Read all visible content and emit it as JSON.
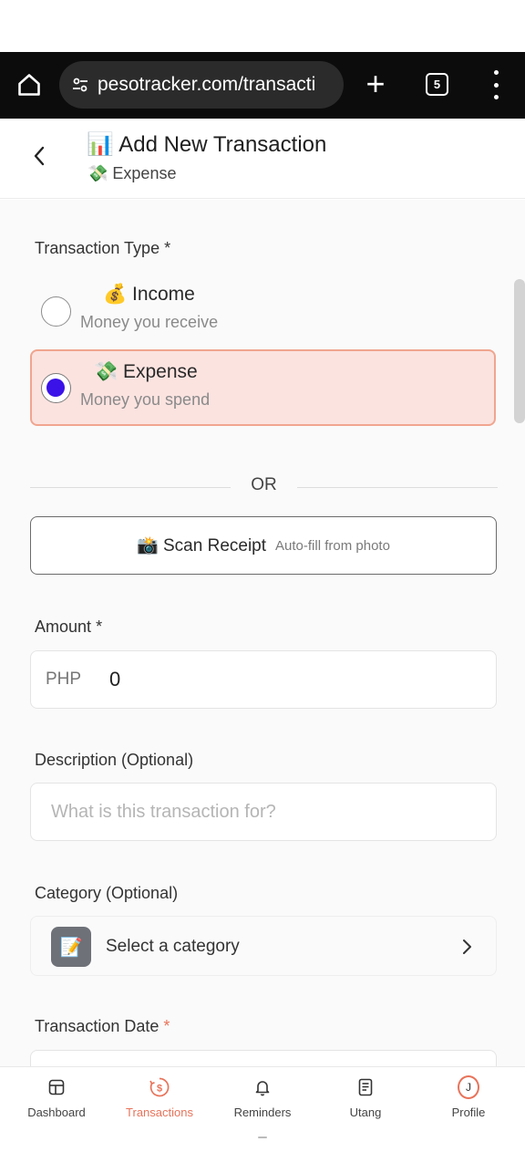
{
  "browser": {
    "url": "pesotracker.com/transacti",
    "tab_count": "5"
  },
  "header": {
    "title": "📊 Add New Transaction",
    "subtitle": "💸 Expense"
  },
  "form": {
    "transaction_type": {
      "label": "Transaction Type",
      "required_mark": "*",
      "options": [
        {
          "title": "💰 Income",
          "description": "Money you receive",
          "selected": false
        },
        {
          "title": "💸 Expense",
          "description": "Money you spend",
          "selected": true
        }
      ]
    },
    "or_text": "OR",
    "scan_receipt": {
      "label": "📸 Scan Receipt",
      "hint": "Auto-fill from photo"
    },
    "amount": {
      "label": "Amount",
      "required_mark": "*",
      "currency": "PHP",
      "value": "0"
    },
    "description": {
      "label": "Description (Optional)",
      "placeholder": "What is this transaction for?"
    },
    "category": {
      "label": "Category (Optional)",
      "icon": "📝",
      "value": "Select a category"
    },
    "transaction_date": {
      "label": "Transaction Date",
      "required_mark": "*"
    }
  },
  "nav": {
    "items": [
      {
        "label": "Dashboard",
        "icon": "dashboard-icon",
        "active": false
      },
      {
        "label": "Transactions",
        "icon": "transactions-icon",
        "active": true
      },
      {
        "label": "Reminders",
        "icon": "bell-icon",
        "active": false
      },
      {
        "label": "Utang",
        "icon": "receipt-icon",
        "active": false
      },
      {
        "label": "Profile",
        "icon": "avatar-icon",
        "active": false,
        "avatar_letter": "J"
      }
    ]
  },
  "colors": {
    "accent": "#e8735a",
    "radio_selected": "#3b12e8",
    "selected_card_bg": "#fbe3e0",
    "selected_card_border": "#f0a58f"
  }
}
